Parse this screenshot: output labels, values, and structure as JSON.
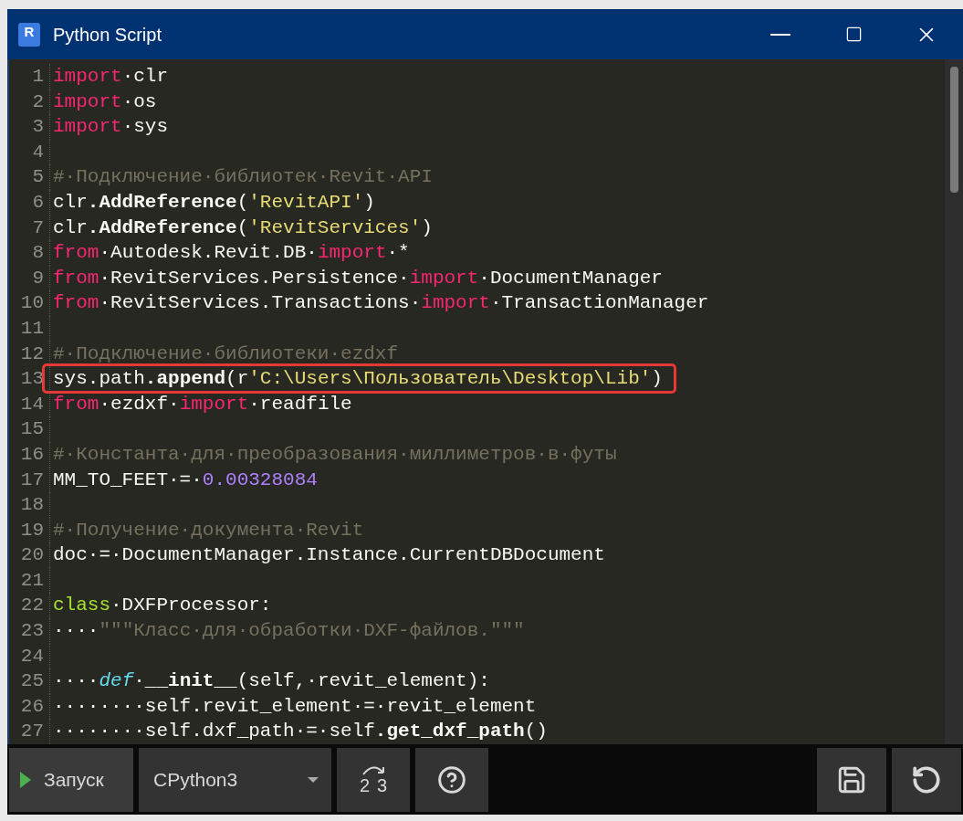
{
  "window": {
    "title": "Python Script",
    "app_icon_letter": "R"
  },
  "editor": {
    "lines": [
      {
        "n": "1",
        "tokens": [
          {
            "kind": "kw",
            "t": "import"
          },
          {
            "kind": "tx",
            "t": "·clr"
          }
        ]
      },
      {
        "n": "2",
        "tokens": [
          {
            "kind": "kw",
            "t": "import"
          },
          {
            "kind": "tx",
            "t": "·os"
          }
        ]
      },
      {
        "n": "3",
        "tokens": [
          {
            "kind": "kw",
            "t": "import"
          },
          {
            "kind": "tx",
            "t": "·sys"
          }
        ]
      },
      {
        "n": "4"
      },
      {
        "n": "5",
        "tokens": [
          {
            "kind": "cm",
            "t": "#·Подключение·библиотек·Revit·API"
          }
        ]
      },
      {
        "n": "6",
        "tokens": [
          {
            "kind": "tx",
            "t": "clr"
          },
          {
            "kind": "fn",
            "t": ".AddReference"
          },
          {
            "kind": "tx",
            "t": "("
          },
          {
            "kind": "str",
            "t": "'RevitAPI'"
          },
          {
            "kind": "tx",
            "t": ")"
          }
        ]
      },
      {
        "n": "7",
        "tokens": [
          {
            "kind": "tx",
            "t": "clr"
          },
          {
            "kind": "fn",
            "t": ".AddReference"
          },
          {
            "kind": "tx",
            "t": "("
          },
          {
            "kind": "str",
            "t": "'RevitServices'"
          },
          {
            "kind": "tx",
            "t": ")"
          }
        ]
      },
      {
        "n": "8",
        "tokens": [
          {
            "kind": "kw",
            "t": "from"
          },
          {
            "kind": "tx",
            "t": "·Autodesk.Revit.DB·"
          },
          {
            "kind": "kw",
            "t": "import"
          },
          {
            "kind": "tx",
            "t": "·*"
          }
        ]
      },
      {
        "n": "9",
        "tokens": [
          {
            "kind": "kw",
            "t": "from"
          },
          {
            "kind": "tx",
            "t": "·RevitServices.Persistence·"
          },
          {
            "kind": "kw",
            "t": "import"
          },
          {
            "kind": "tx",
            "t": "·DocumentManager"
          }
        ]
      },
      {
        "n": "10",
        "tokens": [
          {
            "kind": "kw",
            "t": "from"
          },
          {
            "kind": "tx",
            "t": "·RevitServices.Transactions·"
          },
          {
            "kind": "kw",
            "t": "import"
          },
          {
            "kind": "tx",
            "t": "·TransactionManager"
          }
        ]
      },
      {
        "n": "11"
      },
      {
        "n": "12",
        "tokens": [
          {
            "kind": "cm",
            "t": "#·Подключение·библиотеки·ezdxf"
          }
        ]
      },
      {
        "n": "13",
        "highlighted": true,
        "tokens": [
          {
            "kind": "tx",
            "t": "sys.path"
          },
          {
            "kind": "fn",
            "t": ".append"
          },
          {
            "kind": "tx",
            "t": "(r"
          },
          {
            "kind": "str",
            "t": "'C:\\Users\\Пользователь\\Desktop\\Lib'"
          },
          {
            "kind": "tx",
            "t": ")"
          }
        ]
      },
      {
        "n": "14",
        "tokens": [
          {
            "kind": "kw",
            "t": "from"
          },
          {
            "kind": "tx",
            "t": "·ezdxf·"
          },
          {
            "kind": "kw",
            "t": "import"
          },
          {
            "kind": "tx",
            "t": "·readfile"
          }
        ]
      },
      {
        "n": "15"
      },
      {
        "n": "16",
        "tokens": [
          {
            "kind": "cm",
            "t": "#·Константа·для·преобразования·миллиметров·в·футы"
          }
        ]
      },
      {
        "n": "17",
        "tokens": [
          {
            "kind": "tx",
            "t": "MM_TO_FEET·=·"
          },
          {
            "kind": "num",
            "t": "0.00328084"
          }
        ]
      },
      {
        "n": "18"
      },
      {
        "n": "19",
        "tokens": [
          {
            "kind": "cm",
            "t": "#·Получение·документа·Revit"
          }
        ]
      },
      {
        "n": "20",
        "tokens": [
          {
            "kind": "tx",
            "t": "doc·=·DocumentManager.Instance.CurrentDBDocument"
          }
        ]
      },
      {
        "n": "21"
      },
      {
        "n": "22",
        "tokens": [
          {
            "kind": "cls",
            "t": "class"
          },
          {
            "kind": "tx",
            "t": "·DXFProcessor:"
          }
        ]
      },
      {
        "n": "23",
        "tokens": [
          {
            "kind": "tx",
            "t": "····"
          },
          {
            "kind": "cm",
            "t": "\"\"\"Класс·для·обработки·DXF-файлов.\"\"\""
          }
        ]
      },
      {
        "n": "24"
      },
      {
        "n": "25",
        "tokens": [
          {
            "kind": "tx",
            "t": "····"
          },
          {
            "kind": "def",
            "t": "def"
          },
          {
            "kind": "tx",
            "t": "·"
          },
          {
            "kind": "fn",
            "t": "__init__"
          },
          {
            "kind": "tx",
            "t": "(self,·revit_element):"
          }
        ]
      },
      {
        "n": "26",
        "tokens": [
          {
            "kind": "tx",
            "t": "········self.revit_element·=·revit_element"
          }
        ]
      },
      {
        "n": "27",
        "tokens": [
          {
            "kind": "tx",
            "t": "········self.dxf_path·=·self"
          },
          {
            "kind": "fn",
            "t": ".get_dxf_path"
          },
          {
            "kind": "tx",
            "t": "()"
          }
        ]
      }
    ]
  },
  "toolbar": {
    "run_label": "Запуск",
    "engine": "CPython3",
    "engine_switch": {
      "from": "2",
      "to": "3"
    }
  }
}
